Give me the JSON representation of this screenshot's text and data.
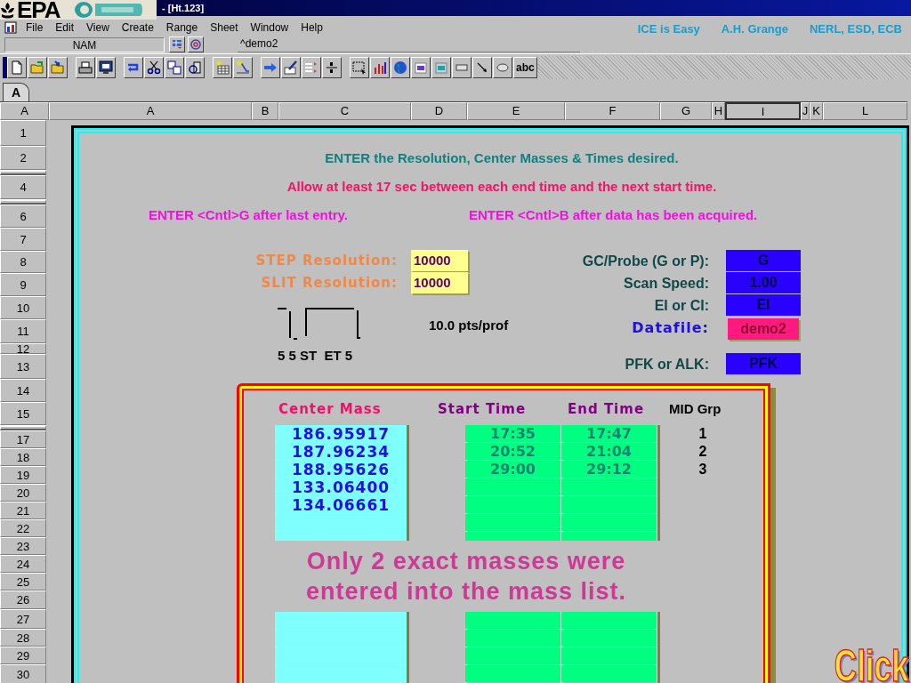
{
  "window": {
    "title": "- [Ht.123]"
  },
  "logo": {
    "text": "EPA"
  },
  "menu": [
    "File",
    "Edit",
    "View",
    "Create",
    "Range",
    "Sheet",
    "Window",
    "Help"
  ],
  "credits": [
    "ICE is Easy",
    "A.H. Grange",
    "NERL, ESD, ECB"
  ],
  "formula_bar": {
    "name_box": "NAM",
    "formula": "^demo2"
  },
  "toolbar": {
    "text_tool": "abc"
  },
  "sheet_tabs": [
    {
      "label": "A",
      "selected": true
    }
  ],
  "columns": [
    {
      "label": "A",
      "selected": false
    },
    {
      "label": "A",
      "selected": false
    },
    {
      "label": "B",
      "selected": false
    },
    {
      "label": "C",
      "selected": false
    },
    {
      "label": "D",
      "selected": false
    },
    {
      "label": "E",
      "selected": false
    },
    {
      "label": "F",
      "selected": false
    },
    {
      "label": "G",
      "selected": false
    },
    {
      "label": "H",
      "selected": false
    },
    {
      "label": "I",
      "selected": true
    },
    {
      "label": "J",
      "selected": false
    },
    {
      "label": "K",
      "selected": false
    },
    {
      "label": "L",
      "selected": false
    }
  ],
  "rows": [
    {
      "label": "1"
    },
    {
      "label": "2"
    },
    {
      "kind": "collapsed"
    },
    {
      "label": "4"
    },
    {
      "kind": "collapsed"
    },
    {
      "label": "6"
    },
    {
      "label": "7"
    },
    {
      "label": "8"
    },
    {
      "label": "9"
    },
    {
      "label": "10"
    },
    {
      "label": "11"
    },
    {
      "label": "12"
    },
    {
      "label": "13"
    },
    {
      "label": "14"
    },
    {
      "label": "15"
    },
    {
      "kind": "collapsed"
    },
    {
      "label": "17"
    },
    {
      "label": "18"
    },
    {
      "label": "19"
    },
    {
      "label": "20"
    },
    {
      "label": "21"
    },
    {
      "label": "22"
    },
    {
      "label": "23"
    },
    {
      "label": "24"
    },
    {
      "label": "25"
    },
    {
      "label": "26"
    },
    {
      "label": "27"
    },
    {
      "label": "28"
    },
    {
      "label": "29"
    },
    {
      "label": "30"
    }
  ],
  "form": {
    "instructions": [
      {
        "kind": "heading",
        "text": "ENTER the Resolution, Center Masses & Times desired."
      },
      {
        "kind": "warning",
        "text": "Allow at least 17 sec between each end time and the next start time."
      }
    ],
    "shortcuts": [
      "ENTER <Cntl>G after last entry.",
      "ENTER <Cntl>B after data has been acquired."
    ],
    "resolutions": [
      {
        "label": "STEP Resolution:",
        "value": "10000"
      },
      {
        "label": "SLIT Resolution:",
        "value": "10000"
      }
    ],
    "points_per_profile": "10.0 pts/prof",
    "pulse_labels": "5 5 ST  ET 5",
    "settings": [
      {
        "label": "GC/Probe (G or P):",
        "value": "G",
        "kind": "option"
      },
      {
        "label": "Scan Speed:",
        "value": "1.00",
        "kind": "option"
      },
      {
        "label": "EI or CI:",
        "value": "EI",
        "kind": "option"
      },
      {
        "label": "Datafile:",
        "value": "demo2",
        "kind": "file"
      },
      {
        "label": "PFK or ALK:",
        "value": "PFK",
        "kind": "option"
      }
    ],
    "table": {
      "columns": [
        "Center Mass",
        "Start Time",
        "End Time",
        "MID Grp"
      ],
      "masses": [
        "186.95917",
        "187.96234",
        "188.95626",
        "133.06400",
        "134.06661"
      ],
      "times": [
        {
          "start": "17:35",
          "end": "17:47"
        },
        {
          "start": "20:52",
          "end": "21:04"
        },
        {
          "start": "29:00",
          "end": "29:12"
        }
      ],
      "groups": [
        "1",
        "2",
        "3"
      ]
    },
    "message": "Only 2 exact masses were\nentered into the mass list."
  },
  "click_label": "Click"
}
